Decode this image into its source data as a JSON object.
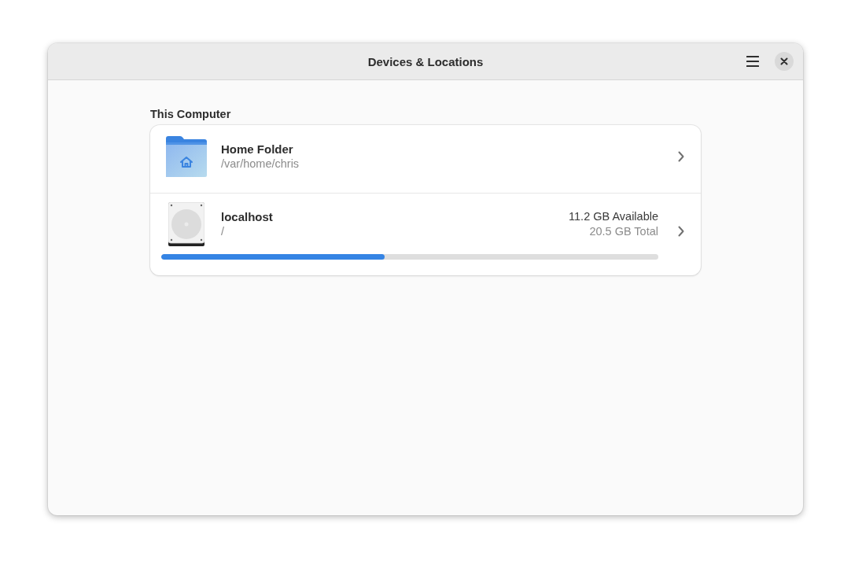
{
  "window": {
    "title": "Devices & Locations"
  },
  "section": {
    "title": "This Computer"
  },
  "locations": [
    {
      "kind": "folder",
      "name": "Home Folder",
      "path": "/var/home/chris"
    },
    {
      "kind": "drive",
      "name": "localhost",
      "path": "/",
      "available": "11.2 GB Available",
      "total": "20.5 GB Total",
      "level": 0.45
    }
  ]
}
